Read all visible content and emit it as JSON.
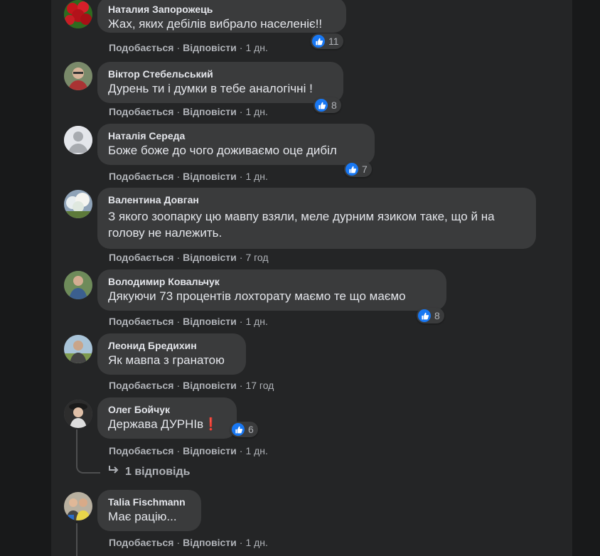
{
  "actions": {
    "like": "Подобається",
    "reply": "Відповісти",
    "dot": "·"
  },
  "comments": [
    {
      "author": "Наталия Запорожець",
      "text": "Жах, яких дебілів вибрало населеніє!!",
      "time": "1 дн.",
      "likes": "11",
      "avatar": "roses-avatar"
    },
    {
      "author": "Віктор Стебельський",
      "text": "Дурень ти і думки в тебе аналогічні !",
      "time": "1 дн.",
      "likes": "8",
      "avatar": "man-glasses-avatar"
    },
    {
      "author": "Наталія Середа",
      "text": "Боже боже до чого доживаємо оце дибіл",
      "time": "1 дн.",
      "likes": "7",
      "avatar": "default-avatar"
    },
    {
      "author": "Валентина Довган",
      "text": "З якого зоопарку цю мавпу взяли, меле дурним язиком таке, що й на голову не належить.",
      "time": "7 год",
      "likes": "",
      "avatar": "blossom-tree-avatar"
    },
    {
      "author": "Володимир Ковальчук",
      "text": "Дякуючи 73 процентів лохторату маємо те що маємо",
      "time": "1 дн.",
      "likes": "8",
      "avatar": "man-outdoor-avatar"
    },
    {
      "author": "Леонид Бредихин",
      "text": "Як мавпа з гранатою",
      "time": "17 год",
      "likes": "",
      "avatar": "man-field-avatar"
    },
    {
      "author": "Олег Бойчук",
      "text": "Держава ДУРНІв",
      "emoji": "❗",
      "time": "1 дн.",
      "likes": "6",
      "avatar": "man-hat-avatar"
    },
    {
      "author": "Talia Fischmann",
      "text": "Має рацію...",
      "time": "1 дн.",
      "likes": "",
      "avatar": "couple-avatar"
    }
  ],
  "replies_link": "1 відповідь",
  "colors": {
    "background": "#18191a",
    "panel": "#242526",
    "bubble": "#3a3b3c",
    "like_blue": "#1877f2"
  }
}
